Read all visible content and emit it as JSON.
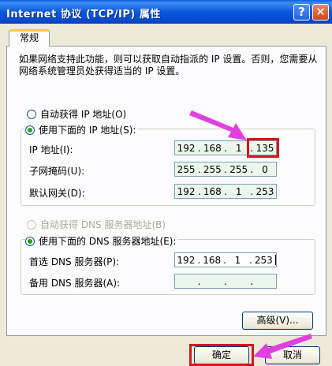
{
  "window": {
    "title": "Internet 协议 (TCP/IP) 属性",
    "help_button": "?",
    "close_button": "✕"
  },
  "tabs": [
    {
      "label": "常规",
      "selected": true
    }
  ],
  "description": "如果网络支持此功能，则可以获取自动指派的 IP 设置。否则，您需要从网络系统管理员处获得适当的 IP 设置。",
  "ip_settings": {
    "auto_option": {
      "label": "自动获得 IP 地址(O)",
      "checked": false
    },
    "manual_option": {
      "label": "使用下面的 IP 地址(S):",
      "checked": true
    },
    "fields": [
      {
        "label": "IP 地址(I):",
        "octets": [
          "192",
          "168",
          "1",
          "135"
        ]
      },
      {
        "label": "子网掩码(U):",
        "octets": [
          "255",
          "255",
          "255",
          "0"
        ]
      },
      {
        "label": "默认网关(D):",
        "octets": [
          "192",
          "168",
          "1",
          "253"
        ]
      }
    ]
  },
  "dns_settings": {
    "auto_option": {
      "label": "自动获得 DNS 服务器地址(B)",
      "checked": false,
      "disabled": true
    },
    "manual_option": {
      "label": "使用下面的 DNS 服务器地址(E):",
      "checked": true
    },
    "fields": [
      {
        "label": "首选 DNS 服务器(P):",
        "octets": [
          "192",
          "168",
          "1",
          "253"
        ]
      },
      {
        "label": "备用 DNS 服务器(A):",
        "octets": [
          "",
          "",
          "",
          ""
        ]
      }
    ]
  },
  "buttons": {
    "advanced": "高级(V)...",
    "ok": "确定",
    "cancel": "取消"
  },
  "colors": {
    "highlight": "#d6161c",
    "annotation_arrow": "#e040e0"
  }
}
